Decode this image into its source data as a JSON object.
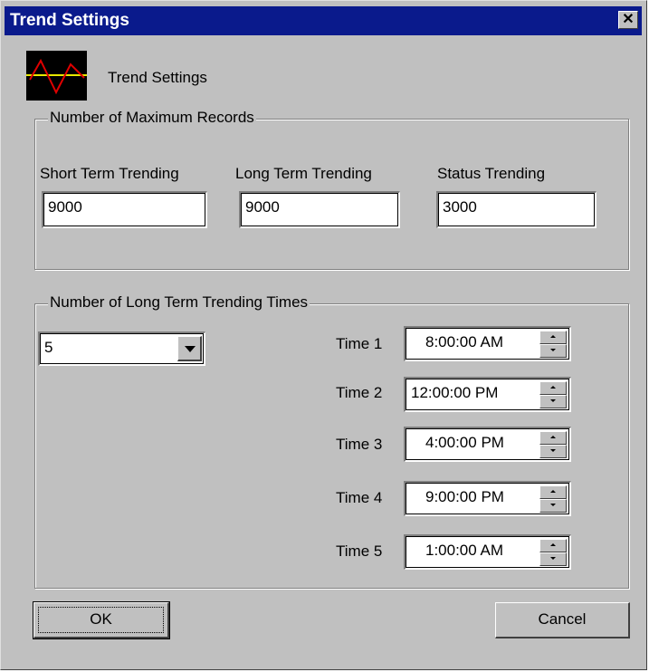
{
  "window": {
    "title": "Trend Settings"
  },
  "header": {
    "label": "Trend Settings",
    "icon": "trend-chart-icon"
  },
  "colors": {
    "titlebar": "#0a1a8c",
    "face": "#c0c0c0",
    "icon_line_red": "#e00000",
    "icon_line_yellow": "#e8e800"
  },
  "max_records": {
    "group_title": "Number of Maximum Records",
    "short_term": {
      "label": "Short Term Trending",
      "value": "9000"
    },
    "long_term": {
      "label": "Long Term Trending",
      "value": "9000"
    },
    "status": {
      "label": "Status Trending",
      "value": "3000"
    }
  },
  "long_term_times": {
    "group_title": "Number of Long Term Trending Times",
    "count_selected": "5",
    "times": [
      {
        "label": "Time 1",
        "value": "8:00:00 AM"
      },
      {
        "label": "Time 2",
        "value": "12:00:00 PM"
      },
      {
        "label": "Time 3",
        "value": "4:00:00 PM"
      },
      {
        "label": "Time 4",
        "value": "9:00:00 PM"
      },
      {
        "label": "Time 5",
        "value": "1:00:00 AM"
      }
    ]
  },
  "buttons": {
    "ok": "OK",
    "cancel": "Cancel"
  }
}
